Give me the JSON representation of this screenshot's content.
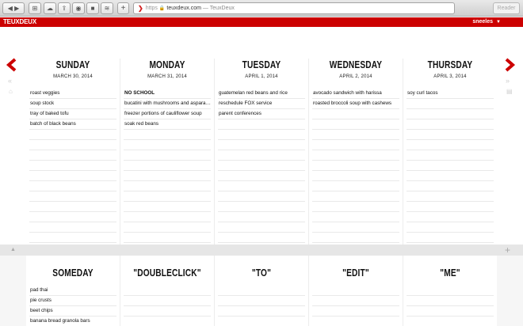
{
  "browser": {
    "url_scheme": "https",
    "url_host": "teuxdeux.com",
    "tab_title": "— TeuxDeux",
    "reader_label": "Reader"
  },
  "app": {
    "logo": "TEUXDEUX",
    "username": "sneeles",
    "accent_color": "#cc0000"
  },
  "days": [
    {
      "name": "SUNDAY",
      "date": "MARCH 30, 2014",
      "items": [
        "roast veggies",
        "soup stock",
        "tray of baked tofu",
        "batch of black beans"
      ]
    },
    {
      "name": "MONDAY",
      "date": "MARCH 31, 2014",
      "items": [
        "NO SCHOOL",
        "bucatini with mushrooms and asparagus",
        "freezer portions of cauliflower soup",
        "soak red beans"
      ]
    },
    {
      "name": "TUESDAY",
      "date": "APRIL 1, 2014",
      "items": [
        "guatemelan red beans and rice",
        "reschedule FOX service",
        "parent conferences"
      ]
    },
    {
      "name": "WEDNESDAY",
      "date": "APRIL 2, 2014",
      "items": [
        "avocado sandwich with harissa",
        "roasted broccoli soup with cashews"
      ]
    },
    {
      "name": "THURSDAY",
      "date": "APRIL 3, 2014",
      "items": [
        "soy curl tacos"
      ]
    }
  ],
  "someday": [
    {
      "name": "SOMEDAY",
      "items": [
        "pad thai",
        "pie crusts",
        "beet chips",
        "banana bread granola bars"
      ]
    },
    {
      "name": "\"DOUBLECLICK\"",
      "items": []
    },
    {
      "name": "\"TO\"",
      "items": []
    },
    {
      "name": "\"EDIT\"",
      "items": []
    },
    {
      "name": "\"ME\"",
      "items": []
    }
  ]
}
